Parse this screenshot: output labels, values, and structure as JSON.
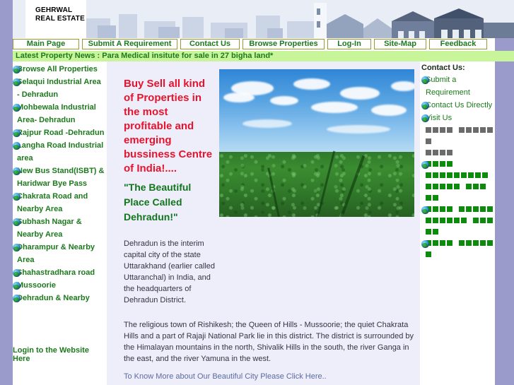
{
  "site": {
    "logo_line1": "GEHRWAL",
    "logo_line2": "REAL ESTATE",
    "logo_text": "GEHRWAL\nREAL ESTATE"
  },
  "colors": {
    "rail_purple": "#9a9acb",
    "news_green_bg": "#c8f59a",
    "link_green": "#1b7a1b",
    "headline_red": "#e8122c",
    "nav_border_olive": "#9a9a33",
    "content_bg": "#eeeefb",
    "tofu_gray": "#6b6b6b",
    "tofu_green": "#0e8a0e"
  },
  "nav": {
    "items": [
      {
        "label": "Main Page",
        "width": "w1"
      },
      {
        "label": "Submit A Requirement",
        "width": "w2"
      },
      {
        "label": "Contact Us",
        "width": "w3"
      },
      {
        "label": "Browse Properties",
        "width": "w4"
      },
      {
        "label": "Log-In",
        "width": "w5"
      },
      {
        "label": "Site-Map",
        "width": "w6"
      },
      {
        "label": "Feedback",
        "width": "w7"
      }
    ]
  },
  "news": {
    "text": "Latest Property News : Para Medical insitute for sale in 27 bigha land*"
  },
  "sidebar": {
    "items": [
      {
        "label": "Browse All Properties"
      },
      {
        "label": "Selaqui Industrial Area - Dehradun"
      },
      {
        "label": "Mohbewala Industrial Area- Dehradun"
      },
      {
        "label": "Rajpur Road -Dehradun"
      },
      {
        "label": "Langha Road Industrial area"
      },
      {
        "label": "New Bus Stand(ISBT) & Haridwar Bye Pass"
      },
      {
        "label": "Chakrata Road and Nearby Area"
      },
      {
        "label": "Subhash Nagar & Nearby Area"
      },
      {
        "label": "Dharampur & Nearby Area"
      },
      {
        "label": "Shahastradhara road"
      },
      {
        "label": "Mussoorie"
      },
      {
        "label": "Dehradun & Nearby"
      }
    ],
    "login_label": "Login to the Website Here"
  },
  "main": {
    "headline": "Buy Sell all kind of Properties in the most profitable and emerging bussiness Centre of India!....",
    "subhead": "\"The Beautiful Place Called Dehradun!\"",
    "paragraph1": "Dehradun is the interim capital city of the state Uttarakhand (earlier called Uttaranchal) in India, and the headquarters of Dehradun District.",
    "paragraph2": "The religious town of Rishikesh; the Queen of Hills - Mussoorie; the quiet Chakrata Hills and a part of Rajaji National Park lie in this district. The district is surrounded by the Himalayan mountains in the north, Shivalik Hills in the south, the river Ganga in the east, and the river Yamuna in the west.",
    "more_link": "To Know More about Our Beautiful City Please Click Here..",
    "hero_image_alt": "green tea field under blue sky with clouds"
  },
  "contact": {
    "title": "Contact Us:",
    "links": [
      {
        "label": "Submit a Requirement"
      },
      {
        "label": "Contact Us Directly"
      },
      {
        "label": "Visit Us"
      }
    ],
    "unrendered_blocks": [
      {
        "color": "gray",
        "groups": [
          4,
          6
        ]
      },
      {
        "color": "gray",
        "groups": [
          4
        ]
      },
      {
        "color": "green",
        "groups": [
          4
        ],
        "bullet": true
      },
      {
        "color": "green",
        "groups": [
          9
        ]
      },
      {
        "color": "green",
        "groups": [
          5,
          3
        ]
      },
      {
        "color": "green",
        "groups": [
          2
        ]
      },
      {
        "color": "green",
        "groups": [
          4,
          5
        ],
        "bullet": true
      },
      {
        "color": "green",
        "groups": [
          6,
          3
        ]
      },
      {
        "color": "green",
        "groups": [
          2
        ]
      },
      {
        "color": "green",
        "groups": [
          4,
          6
        ],
        "bullet": true
      }
    ]
  },
  "scrollbar": {
    "up_arrow": "scroll-up-arrow",
    "position_percent": 0
  }
}
